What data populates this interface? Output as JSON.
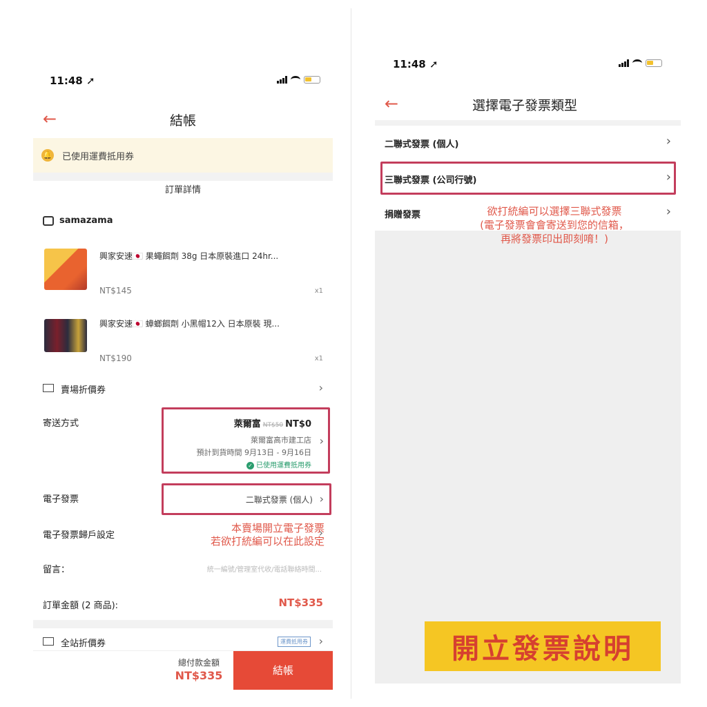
{
  "left": {
    "status": {
      "time": "11:48 ➚"
    },
    "nav": {
      "title": "結帳"
    },
    "notice": {
      "text": "已使用運費抵用券"
    },
    "order_details_label": "訂單詳情",
    "shop": {
      "name": "samazama"
    },
    "items": [
      {
        "name": "興家安速🇯🇵 果蠅餌劑 38g 日本原裝進口 24hr...",
        "price": "NT$145",
        "qty": "x1"
      },
      {
        "name": "興家安速🇯🇵 蟑螂餌劑 小黑帽12入 日本原裝 現...",
        "price": "NT$190",
        "qty": "x1"
      }
    ],
    "store_coupon": {
      "label": "賣場折價券"
    },
    "shipping": {
      "label": "寄送方式",
      "carrier": "萊爾富",
      "original_fee": "NT$50",
      "fee": "NT$0",
      "store": "萊爾富高市建工店",
      "eta": "預計到貨時間 9月13日 - 9月16日",
      "coupon_used": "已使用運費抵用券"
    },
    "einvoice": {
      "label": "電子發票",
      "value": "二聯式發票 (個人)"
    },
    "einvoice_carrier": {
      "label": "電子發票歸戶設定"
    },
    "note_line1": "本賣場開立電子發票",
    "note_line2": "若欲打統編可以在此設定",
    "message": {
      "label": "留言：",
      "placeholder": "統一編號/管理室代收/電話聯絡時間..."
    },
    "order_total": {
      "label": "訂單金額 (2 商品):",
      "value": "NT$335"
    },
    "site_coupon": {
      "label": "全站折價券",
      "tag": "運費抵用券"
    },
    "bottom": {
      "total_label": "總付款金額",
      "total_value": "NT$335",
      "checkout_label": "結帳"
    }
  },
  "right": {
    "status": {
      "time": "11:48 ➚"
    },
    "nav": {
      "title": "選擇電子發票類型"
    },
    "options": [
      {
        "label": "二聯式發票 (個人)"
      },
      {
        "label": "三聯式發票 (公司行號)"
      },
      {
        "label": "捐贈發票"
      }
    ],
    "note_lines": [
      "欲打統編可以選擇三聯式發票",
      "(電子發票會會寄送到您的信箱，",
      "再將發票印出即刻唷！)"
    ],
    "banner": "開立發票說明"
  },
  "colors": {
    "accent": "#e64a37",
    "highlight_border": "#c33d5c",
    "banner_bg": "#f5c623",
    "banner_text": "#d64030"
  }
}
